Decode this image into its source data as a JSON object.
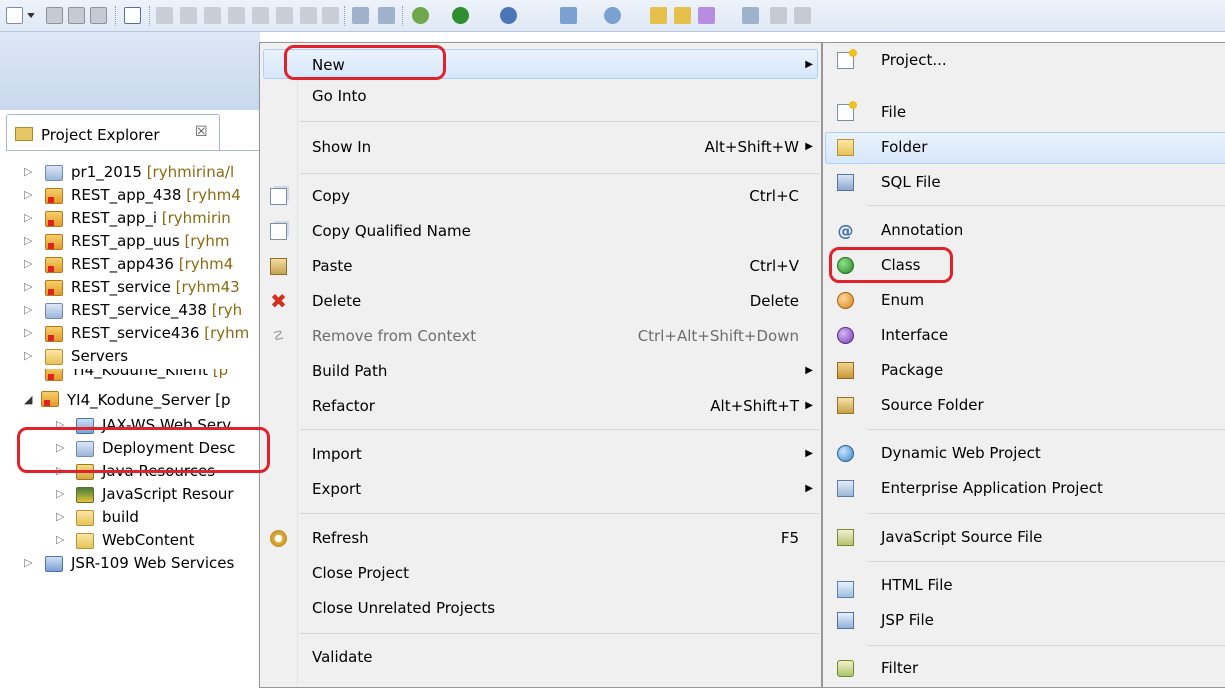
{
  "toolbar": {
    "icons": [
      "new-wizard-icon",
      "dropdown-icon",
      "save-icon",
      "save-all-icon",
      "print-icon",
      "toggle-breakpoints-icon",
      "resume-icon",
      "suspend-icon",
      "terminate-icon",
      "disconnect-icon",
      "step-into-icon",
      "step-over-icon",
      "step-return-icon",
      "drop-to-frame-icon",
      "use-step-filters-icon",
      "debug-icon",
      "run-icon",
      "external-tools-icon",
      "new-web-project-icon",
      "new-server-icon",
      "open-type-icon",
      "open-task-icon",
      "search-icon",
      "perspective-icon"
    ]
  },
  "explorer": {
    "title": "Project Explorer",
    "close_glyph": "☒",
    "items": [
      {
        "label": "pr1_2015",
        "deco": "[ryhmirina/l",
        "icon": "project-folder-icon"
      },
      {
        "label": "REST_app_438",
        "deco": "[ryhm4",
        "icon": "web-project-error-icon"
      },
      {
        "label": "REST_app_i",
        "deco": "[ryhmirin",
        "icon": "web-project-warning-icon"
      },
      {
        "label": "REST_app_uus",
        "deco": "[ryhm",
        "icon": "web-project-warning-icon"
      },
      {
        "label": "REST_app436",
        "deco": "[ryhm4",
        "icon": "web-project-warning-icon"
      },
      {
        "label": "REST_service",
        "deco": "[ryhm43",
        "icon": "web-project-warning-icon"
      },
      {
        "label": "REST_service_438",
        "deco": "[ryh",
        "icon": "project-folder-icon"
      },
      {
        "label": "REST_service436",
        "deco": "[ryhm",
        "icon": "web-project-warning-icon"
      },
      {
        "label": "Servers",
        "deco": "",
        "icon": "servers-folder-icon"
      },
      {
        "label": "YI4_Kodune_Klient",
        "deco": "[p",
        "icon": "web-project-error-icon"
      },
      {
        "label": "YI4_Kodune_Server",
        "deco": "[p",
        "icon": "web-project-error-icon"
      },
      {
        "label": "JAX-WS Web Serv",
        "deco": "",
        "icon": "jax-ws-icon"
      },
      {
        "label": "Deployment Desc",
        "deco": "",
        "icon": "deployment-descriptor-icon"
      },
      {
        "label": "Java Resources",
        "deco": "",
        "icon": "java-resources-icon"
      },
      {
        "label": "JavaScript Resour",
        "deco": "",
        "icon": "javascript-resources-icon"
      },
      {
        "label": "build",
        "deco": "",
        "icon": "folder-icon"
      },
      {
        "label": "WebContent",
        "deco": "",
        "icon": "folder-icon"
      },
      {
        "label": "JSR-109 Web Services",
        "deco": "",
        "icon": "web-services-icon"
      }
    ]
  },
  "menu": {
    "items": [
      {
        "label": "New",
        "accel": "",
        "submenu": true
      },
      {
        "label": "Go Into",
        "accel": "",
        "submenu": false
      },
      {
        "label": "Show In",
        "accel": "Alt+Shift+W",
        "submenu": true
      },
      {
        "label": "Copy",
        "accel": "Ctrl+C",
        "submenu": false
      },
      {
        "label": "Copy Qualified Name",
        "accel": "",
        "submenu": false
      },
      {
        "label": "Paste",
        "accel": "Ctrl+V",
        "submenu": false
      },
      {
        "label": "Delete",
        "accel": "Delete",
        "submenu": false
      },
      {
        "label": "Remove from Context",
        "accel": "Ctrl+Alt+Shift+Down",
        "submenu": false,
        "disabled": true
      },
      {
        "label": "Build Path",
        "accel": "",
        "submenu": true
      },
      {
        "label": "Refactor",
        "accel": "Alt+Shift+T",
        "submenu": true
      },
      {
        "label": "Import",
        "accel": "",
        "submenu": true
      },
      {
        "label": "Export",
        "accel": "",
        "submenu": true
      },
      {
        "label": "Refresh",
        "accel": "F5",
        "submenu": false
      },
      {
        "label": "Close Project",
        "accel": "",
        "submenu": false
      },
      {
        "label": "Close Unrelated Projects",
        "accel": "",
        "submenu": false
      },
      {
        "label": "Validate",
        "accel": "",
        "submenu": false
      }
    ],
    "arrow_glyph": "▶"
  },
  "submenu": {
    "items": [
      {
        "label": "Project...",
        "icon": "new-project-icon"
      },
      {
        "label": "File",
        "icon": "new-file-icon"
      },
      {
        "label": "Folder",
        "icon": "new-folder-icon"
      },
      {
        "label": "SQL File",
        "icon": "sql-file-icon"
      },
      {
        "label": "Annotation",
        "icon": "annotation-icon"
      },
      {
        "label": "Class",
        "icon": "class-icon"
      },
      {
        "label": "Enum",
        "icon": "enum-icon"
      },
      {
        "label": "Interface",
        "icon": "interface-icon"
      },
      {
        "label": "Package",
        "icon": "package-icon"
      },
      {
        "label": "Source Folder",
        "icon": "source-folder-icon"
      },
      {
        "label": "Dynamic Web Project",
        "icon": "dynamic-web-project-icon"
      },
      {
        "label": "Enterprise Application Project",
        "icon": "enterprise-application-icon"
      },
      {
        "label": "JavaScript Source File",
        "icon": "javascript-file-icon"
      },
      {
        "label": "HTML File",
        "icon": "html-file-icon"
      },
      {
        "label": "JSP File",
        "icon": "jsp-file-icon"
      },
      {
        "label": "Filter",
        "icon": "filter-icon"
      }
    ]
  },
  "colors": {
    "callout": "#e0232b",
    "highlight": "#d6e7fb",
    "menu_bg": "#f0f0f0"
  }
}
